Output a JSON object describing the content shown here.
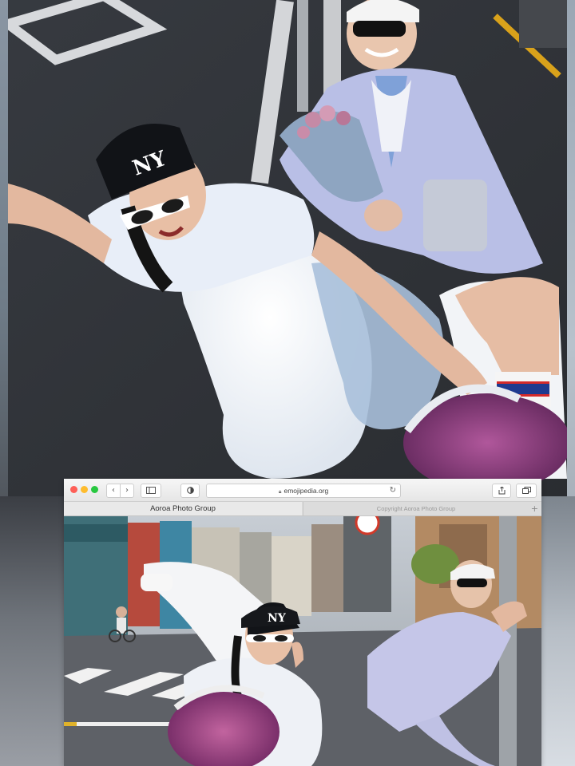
{
  "browser": {
    "url": "emojipedia.org",
    "tabs": [
      {
        "label": "Aoroa Photo Group",
        "active": true
      },
      {
        "label": "Copyright Aoroa Photo Group",
        "active": false
      }
    ],
    "icons": {
      "back": "chevron-left-icon",
      "forward": "chevron-right-icon",
      "sidebar": "sidebar-icon",
      "privacy": "shield-icon",
      "lock": "lock-icon",
      "reload": "reload-icon",
      "share": "share-icon",
      "tabs": "tabs-overview-icon",
      "new_tab": "plus-icon"
    },
    "traffic_colors": {
      "close": "#fe5f57",
      "minimize": "#febc2e",
      "zoom": "#28c840"
    }
  },
  "photos": {
    "top_caption": "",
    "bottom_caption": ""
  }
}
